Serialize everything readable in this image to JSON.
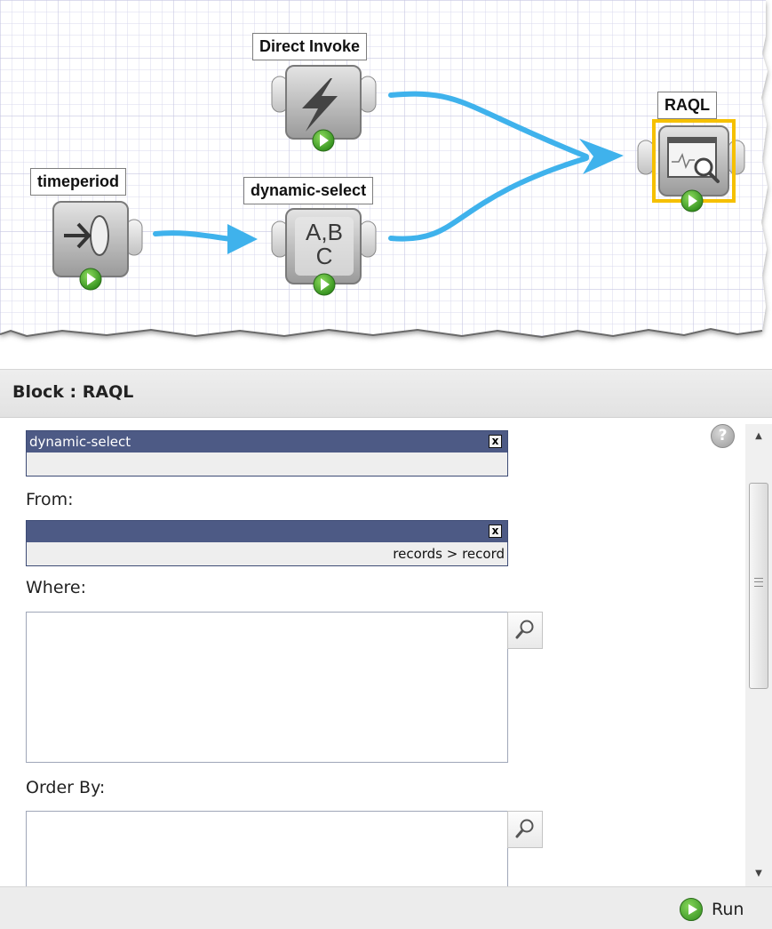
{
  "canvas": {
    "nodes": [
      {
        "id": "direct-invoke",
        "label": "Direct Invoke",
        "icon": "lightning-icon",
        "selected": false
      },
      {
        "id": "timeperiod",
        "label": "timeperiod",
        "icon": "timeperiod-icon",
        "selected": false
      },
      {
        "id": "dynamic-select",
        "label": "dynamic-select",
        "icon": "abc-select-icon",
        "glyph_top": "A,B",
        "glyph_bottom": "C",
        "selected": false
      },
      {
        "id": "raql",
        "label": "RAQL",
        "icon": "magnifier-chart-icon",
        "selected": true
      }
    ],
    "connections": [
      {
        "from": "timeperiod",
        "to": "dynamic-select"
      },
      {
        "from": "dynamic-select",
        "to": "raql"
      },
      {
        "from": "direct-invoke",
        "to": "raql"
      }
    ],
    "colors": {
      "connector": "#3fb2ec",
      "selection": "#f5c000",
      "run_badge": "#3ca01e"
    }
  },
  "panel": {
    "title": "Block : RAQL",
    "help_glyph": "?",
    "mapping_1": {
      "name": "dynamic-select",
      "remove": "x",
      "path": ""
    },
    "from_label": "From:",
    "mapping_2": {
      "name": "",
      "remove": "x",
      "path": "records > record"
    },
    "where_label": "Where:",
    "where_value": "",
    "order_label": "Order By:",
    "order_value": "",
    "run_label": "Run",
    "colors": {
      "mapping_header": "#4d5a85",
      "header_bg": "#e8e8e8"
    }
  }
}
